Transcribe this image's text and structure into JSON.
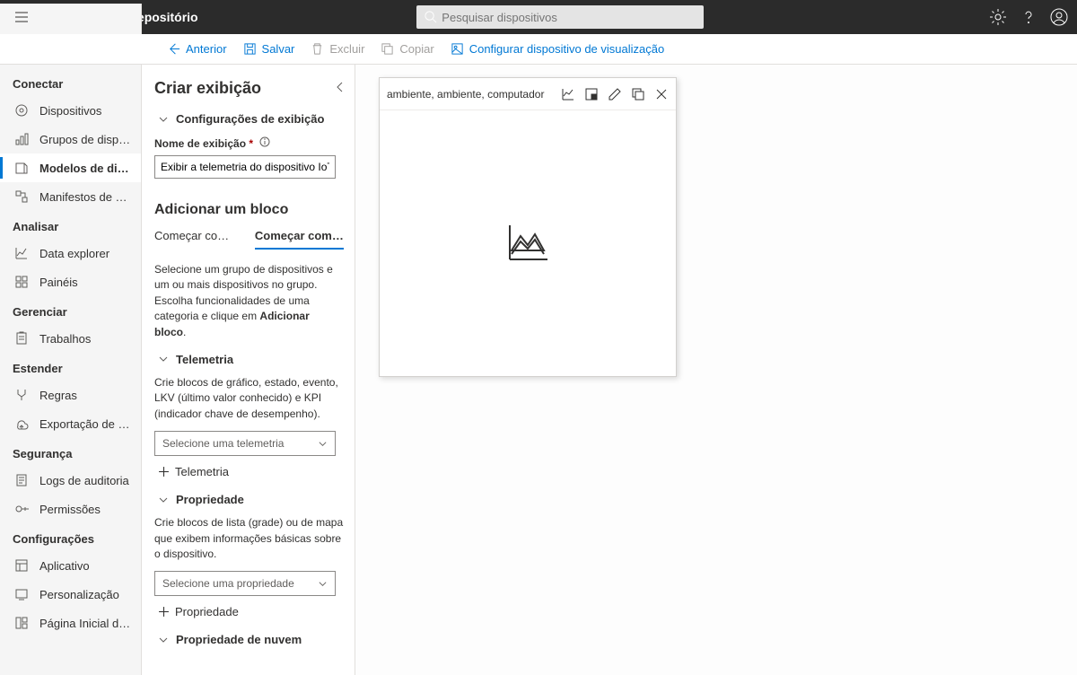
{
  "topbar": {
    "title": "Gerenciamento do Repositório",
    "search_placeholder": "Pesquisar dispositivos"
  },
  "cmdbar": {
    "back": "Anterior",
    "save": "Salvar",
    "delete": "Excluir",
    "copy": "Copiar",
    "configure": "Configurar dispositivo de visualização"
  },
  "nav": {
    "g1": "Conectar",
    "i_devices": "Dispositivos",
    "i_groups": "Grupos de dispositivos",
    "i_templates": "Modelos de dispo...",
    "i_edge": "Manifestos de borda",
    "g2": "Analisar",
    "i_explorer": "Data explorer",
    "i_panels": "Painéis",
    "g3": "Gerenciar",
    "i_jobs": "Trabalhos",
    "g4": "Estender",
    "i_rules": "Regras",
    "i_export": "Exportação de dados",
    "g5": "Segurança",
    "i_audit": "Logs de auditoria",
    "i_perm": "Permissões",
    "g6": "Configurações",
    "i_app": "Aplicativo",
    "i_pers": "Personalização",
    "i_home": "Página Inicial do IoT C"
  },
  "panel": {
    "title": "Criar exibição",
    "sec_display": "Configurações de exibição",
    "lbl_name": "Nome de exibição",
    "input_name": "Exibir a telemetria do dispositivo IoT Edge",
    "h_addblock": "Adicionar um bloco",
    "tab1": "Começar com u...",
    "tab2": "Começar com d...",
    "desc1a": "Selecione um grupo de dispositivos e um ou mais dispositivos no grupo. Escolha funcionalidades de uma categoria e clique em ",
    "desc1b": "Adicionar bloco",
    "sec_tel": "Telemetria",
    "desc_tel": "Crie blocos de gráfico, estado, evento, LKV (último valor conhecido) e KPI (indicador chave de desempenho).",
    "ddl_tel": "Selecione uma telemetria",
    "add_tel": "Telemetria",
    "sec_prop": "Propriedade",
    "desc_prop": "Crie blocos de lista (grade) ou de mapa que exibem informações básicas sobre o dispositivo.",
    "ddl_prop": "Selecione uma propriedade",
    "add_prop": "Propriedade",
    "sec_cloud": "Propriedade de nuvem"
  },
  "tile": {
    "title": "ambiente, ambiente, computador"
  }
}
